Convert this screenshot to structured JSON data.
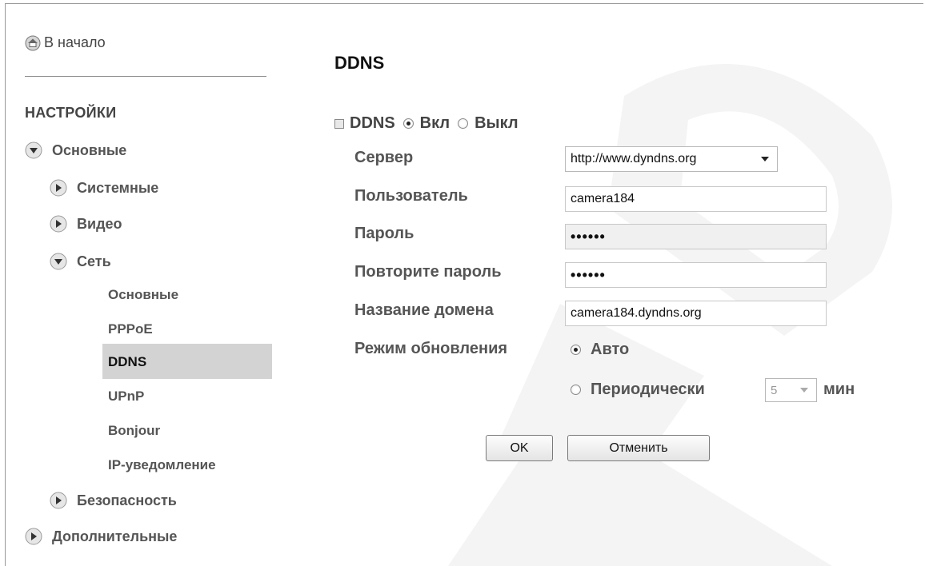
{
  "sidebar": {
    "home_label": "В начало",
    "settings_title": "НАСТРОЙКИ",
    "basic_label": "Основные",
    "system_label": "Системные",
    "video_label": "Видео",
    "network_label": "Сеть",
    "network_sub": {
      "basic": "Основные",
      "pppoe": "PPPoE",
      "ddns": "DDNS",
      "upnp": "UPnP",
      "bonjour": "Bonjour",
      "ip_notify": "IP-уведомление"
    },
    "security_label": "Безопасность",
    "advanced_label": "Дополнительные"
  },
  "main": {
    "title": "DDNS",
    "ddns_label": "DDNS",
    "on_label": "Вкл",
    "off_label": "Выкл",
    "ddns_enabled": true,
    "server_label": "Сервер",
    "server_value": "http://www.dyndns.org",
    "user_label": "Пользователь",
    "user_value": "camera184",
    "password_label": "Пароль",
    "password_value": "••••••",
    "repeat_password_label": "Повторите пароль",
    "repeat_password_value": "••••••",
    "domain_label": "Название домена",
    "domain_value": "camera184.dyndns.org",
    "update_mode_label": "Режим обновления",
    "mode_auto_label": "Авто",
    "mode_periodic_label": "Периодически",
    "update_mode_selected": "auto",
    "interval_value": "5",
    "interval_unit": "мин",
    "ok_label": "OK",
    "cancel_label": "Отменить"
  },
  "icons": {
    "home": "home-icon",
    "expanded": "arrow-down-icon",
    "collapsed": "arrow-right-icon",
    "watermark": "logo-watermark"
  },
  "colors": {
    "active_nav_bg": "#d3d3d3",
    "watermark": "#f4f4f4"
  }
}
